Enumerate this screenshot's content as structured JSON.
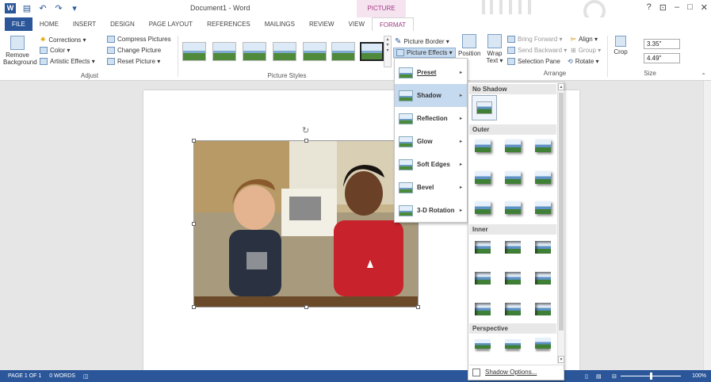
{
  "window": {
    "title": "Document1 - Word",
    "contextual_tab": "PICTURE TOOLS",
    "controls": [
      "?",
      "⊡",
      "–",
      "□",
      "✕"
    ]
  },
  "quick_access": {
    "save_icon": "save-icon",
    "undo_icon": "undo-icon",
    "redo_icon": "redo-icon"
  },
  "tabs": [
    "FILE",
    "HOME",
    "INSERT",
    "DESIGN",
    "PAGE LAYOUT",
    "REFERENCES",
    "MAILINGS",
    "REVIEW",
    "VIEW",
    "FORMAT"
  ],
  "ribbon": {
    "adjust": {
      "remove_background": "Remove Background",
      "corrections": "Corrections ▾",
      "color": "Color ▾",
      "artistic_effects": "Artistic Effects ▾",
      "compress": "Compress Pictures",
      "change": "Change Picture",
      "reset": "Reset Picture ▾",
      "label": "Adjust"
    },
    "styles": {
      "label": "Picture Styles"
    },
    "format": {
      "picture_border": "Picture Border ▾",
      "picture_effects": "Picture Effects ▾",
      "position": "Position",
      "wrap_text": "Wrap Text ▾"
    },
    "arrange": {
      "bring_forward": "Bring Forward ▾",
      "send_backward": "Send Backward ▾",
      "selection_pane": "Selection Pane",
      "align": "Align ▾",
      "group": "Group ▾",
      "rotate": "Rotate ▾",
      "label": "Arrange"
    },
    "size": {
      "crop": "Crop",
      "height": "3.35\"",
      "width": "4.49\"",
      "label": "Size"
    }
  },
  "effects_menu": [
    {
      "label": "Preset",
      "icon": "preset-icon"
    },
    {
      "label": "Shadow",
      "icon": "shadow-icon"
    },
    {
      "label": "Reflection",
      "icon": "reflection-icon"
    },
    {
      "label": "Glow",
      "icon": "glow-icon"
    },
    {
      "label": "Soft Edges",
      "icon": "soft-edges-icon"
    },
    {
      "label": "Bevel",
      "icon": "bevel-icon"
    },
    {
      "label": "3-D Rotation",
      "icon": "3d-rotation-icon"
    }
  ],
  "shadow_panel": {
    "sections": {
      "none": "No Shadow",
      "outer": "Outer",
      "inner": "Inner",
      "perspective": "Perspective"
    },
    "options": "Shadow Options..."
  },
  "status_bar": {
    "page": "PAGE 1 OF 1",
    "words": "0 WORDS",
    "zoom": "100%"
  },
  "colors": {
    "accent": "#2b579a",
    "contextual": "#a13a84",
    "menu_highlight": "#c5d9ef"
  }
}
